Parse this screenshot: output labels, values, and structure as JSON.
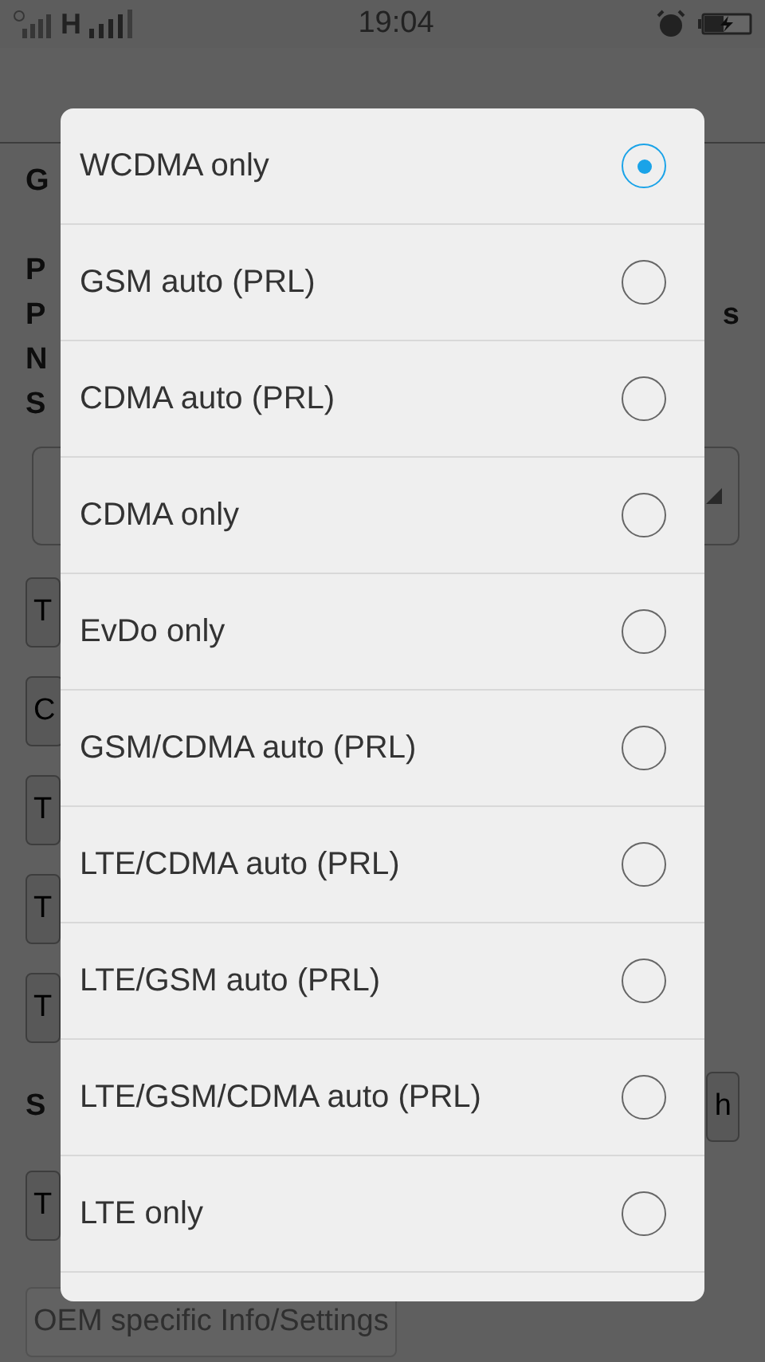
{
  "status_bar": {
    "network": "H",
    "time": "19:04"
  },
  "background": {
    "labels": [
      {
        "text": "G"
      },
      {
        "text": "P"
      },
      {
        "text": "P",
        "right": "s"
      },
      {
        "text": "N"
      },
      {
        "text": "S"
      }
    ],
    "buttons": [
      {
        "label": "T",
        "enabled": true
      },
      {
        "label": "C",
        "enabled": true
      },
      {
        "label": "T",
        "enabled": true
      },
      {
        "label": "T",
        "enabled": true
      },
      {
        "label": "T",
        "enabled": true
      }
    ],
    "sms_row": {
      "label": "S",
      "button": "h"
    },
    "buttons_lower": [
      {
        "label": "T",
        "enabled": true
      },
      {
        "label": "OEM specific Info/Settings",
        "enabled": false
      }
    ]
  },
  "dialog": {
    "options": [
      {
        "label": "WCDMA only",
        "selected": true
      },
      {
        "label": "GSM auto (PRL)",
        "selected": false
      },
      {
        "label": "CDMA auto (PRL)",
        "selected": false
      },
      {
        "label": "CDMA only",
        "selected": false
      },
      {
        "label": "EvDo only",
        "selected": false
      },
      {
        "label": "GSM/CDMA auto (PRL)",
        "selected": false
      },
      {
        "label": "LTE/CDMA auto (PRL)",
        "selected": false
      },
      {
        "label": "LTE/GSM auto (PRL)",
        "selected": false
      },
      {
        "label": "LTE/GSM/CDMA auto (PRL)",
        "selected": false
      },
      {
        "label": "LTE only",
        "selected": false
      }
    ]
  }
}
